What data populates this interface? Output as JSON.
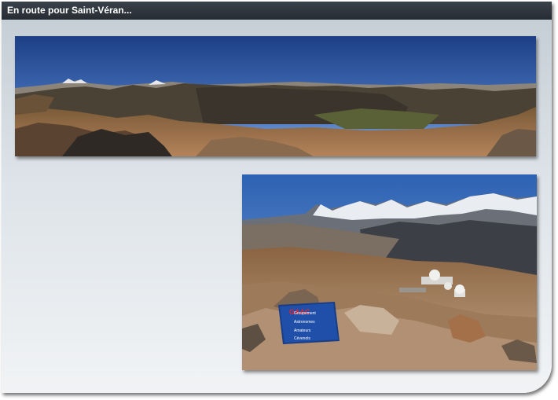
{
  "window": {
    "title": "En route pour Saint-Véran..."
  },
  "photos": [
    {
      "name": "panorama",
      "subject": "mountain-panorama-photo"
    },
    {
      "name": "observatory",
      "subject": "observatory-mountain-photo",
      "sign_text": [
        "Groupement",
        "Astronomes",
        "Amateurs",
        "Cévenols"
      ],
      "sign_acronym": "GAAC"
    }
  ]
}
